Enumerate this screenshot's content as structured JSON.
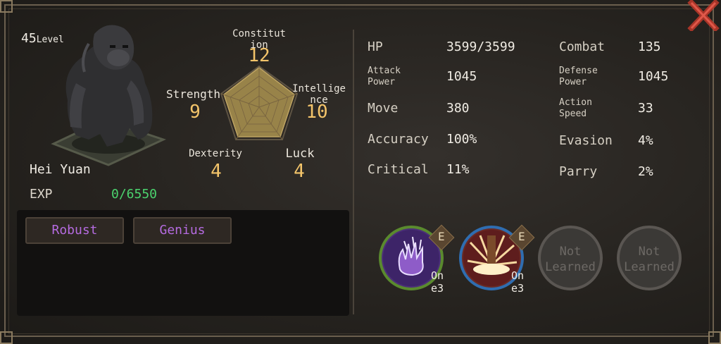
{
  "character": {
    "level_number": "45",
    "level_label": "Level",
    "name": "Hei Yuan",
    "exp_label": "EXP",
    "exp_value": "0/6550"
  },
  "attributes": {
    "constitution": {
      "label": "Constitut\nion",
      "value": "12"
    },
    "strength": {
      "label": "Strength",
      "value": "9"
    },
    "intelligence": {
      "label": "Intellige\nnce",
      "value": "10"
    },
    "dexterity": {
      "label": "Dexterity",
      "value": "4"
    },
    "luck": {
      "label": "Luck",
      "value": "4"
    }
  },
  "traits": [
    "Robust",
    "Genius"
  ],
  "stats": {
    "hp": {
      "label": "HP",
      "value": "3599/3599"
    },
    "combat": {
      "label": "Combat",
      "value": "135"
    },
    "attack_power": {
      "label": "Attack\nPower",
      "value": "1045"
    },
    "defense_power": {
      "label": "Defense\nPower",
      "value": "1045"
    },
    "move": {
      "label": "Move",
      "value": "380"
    },
    "action_speed": {
      "label": "Action\nSpeed",
      "value": "33"
    },
    "accuracy": {
      "label": "Accuracy",
      "value": "100%"
    },
    "evasion": {
      "label": "Evasion",
      "value": "4%"
    },
    "critical": {
      "label": "Critical",
      "value": "11%"
    },
    "parry": {
      "label": "Parry",
      "value": "2%"
    }
  },
  "skills": [
    {
      "icon": "purple-claw-skill-icon",
      "badge": "E",
      "tag": "On\ne3"
    },
    {
      "icon": "earth-burst-skill-icon",
      "badge": "E",
      "tag": "On\ne3"
    },
    {
      "label": "Not\nLearned"
    },
    {
      "label": "Not\nLearned"
    }
  ],
  "colors": {
    "attribute_value": "#f3c46a",
    "exp_value": "#4bd36e",
    "trait_text": "#b56be0",
    "radar_fill": "#a8904f",
    "close_icon": "#c0392b"
  }
}
